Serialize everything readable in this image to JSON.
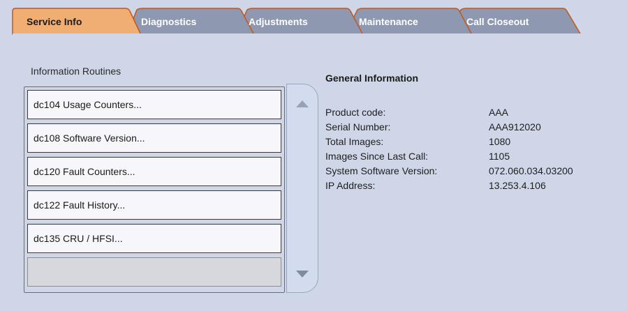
{
  "tabs": [
    {
      "label": "Service Info",
      "active": true
    },
    {
      "label": "Diagnostics",
      "active": false
    },
    {
      "label": "Adjustments",
      "active": false
    },
    {
      "label": "Maintenance",
      "active": false
    },
    {
      "label": "Call Closeout",
      "active": false
    }
  ],
  "routines": {
    "title": "Information Routines",
    "items": [
      "dc104 Usage Counters...",
      "dc108 Software Version...",
      "dc120 Fault Counters...",
      "dc122 Fault History...",
      "dc135 CRU / HFSI..."
    ]
  },
  "general": {
    "title": "General Information",
    "rows": [
      {
        "label": "Product code:",
        "value": "AAA"
      },
      {
        "label": "Serial Number:",
        "value": "AAA912020"
      },
      {
        "label": "Total Images:",
        "value": "1080"
      },
      {
        "label": "Images Since Last Call:",
        "value": "1105"
      },
      {
        "label": "System Software Version:",
        "value": "072.060.034.03200"
      },
      {
        "label": "IP Address:",
        "value": "13.253.4.106"
      }
    ]
  },
  "colors": {
    "active_tab": "#f1ae73",
    "inactive_tab": "#8f9ab3",
    "panel_bg": "#cfd6e8",
    "tab_outline": "#c2571c"
  },
  "icons": {
    "scroll_up": "triangle-up-icon",
    "scroll_down": "triangle-down-icon"
  }
}
